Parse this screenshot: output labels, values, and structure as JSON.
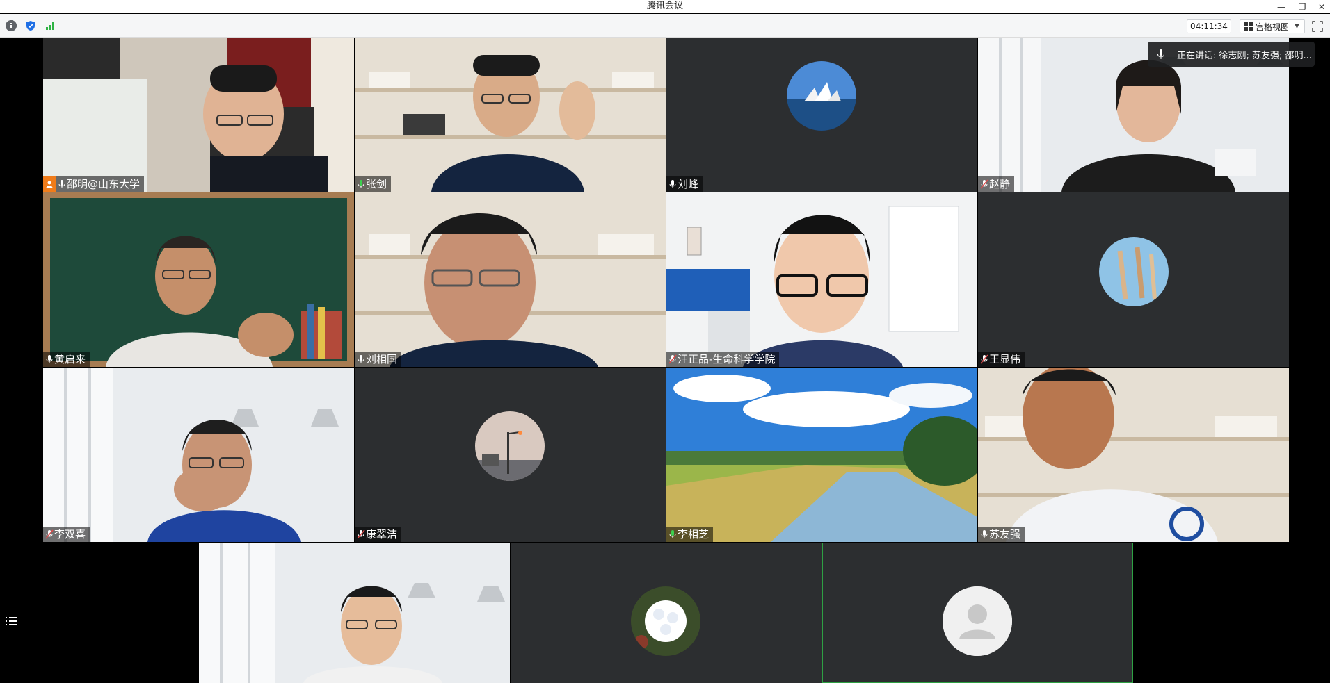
{
  "window": {
    "title": "腾讯会议",
    "minimize": "—",
    "restore": "❐",
    "close": "✕"
  },
  "toolbar": {
    "info_icon": "info-icon",
    "shield_icon": "shield-icon",
    "signal_icon": "signal-icon",
    "timer": "04:11:34",
    "view_label": "宫格视图",
    "view_caret": "▼",
    "fullscreen_icon": "fullscreen-icon"
  },
  "speaking": {
    "text": "正在讲话: 徐志刚; 苏友强; 邵明..."
  },
  "participants": [
    {
      "name": "邵明@山东大学",
      "host": true,
      "mic": "on",
      "kind": "video"
    },
    {
      "name": "张剑",
      "mic": "speaking",
      "kind": "video"
    },
    {
      "name": "刘峰",
      "mic": "on",
      "kind": "avatar"
    },
    {
      "name": "赵静",
      "mic": "muted",
      "kind": "video"
    },
    {
      "name": "黄启来",
      "mic": "on",
      "kind": "video"
    },
    {
      "name": "刘相国",
      "mic": "on",
      "kind": "video"
    },
    {
      "name": "汪正品-生命科学学院",
      "mic": "muted",
      "kind": "video"
    },
    {
      "name": "王显伟",
      "mic": "muted",
      "kind": "avatar"
    },
    {
      "name": "李双喜",
      "mic": "muted",
      "kind": "video"
    },
    {
      "name": "康翠洁",
      "mic": "muted",
      "kind": "avatar"
    },
    {
      "name": "李相芝",
      "mic": "speaking",
      "kind": "video"
    },
    {
      "name": "苏友强",
      "mic": "on",
      "kind": "video"
    },
    {
      "name": "",
      "kind": "video"
    },
    {
      "name": "",
      "kind": "avatar"
    },
    {
      "name": "",
      "kind": "default-avatar"
    }
  ],
  "colors": {
    "tile_bg": "#2c2e30",
    "host_badge": "#f07c1a",
    "active_border": "#2ea043",
    "mic_speaking": "#3ccf4e",
    "mic_muted": "#e04b4b"
  }
}
